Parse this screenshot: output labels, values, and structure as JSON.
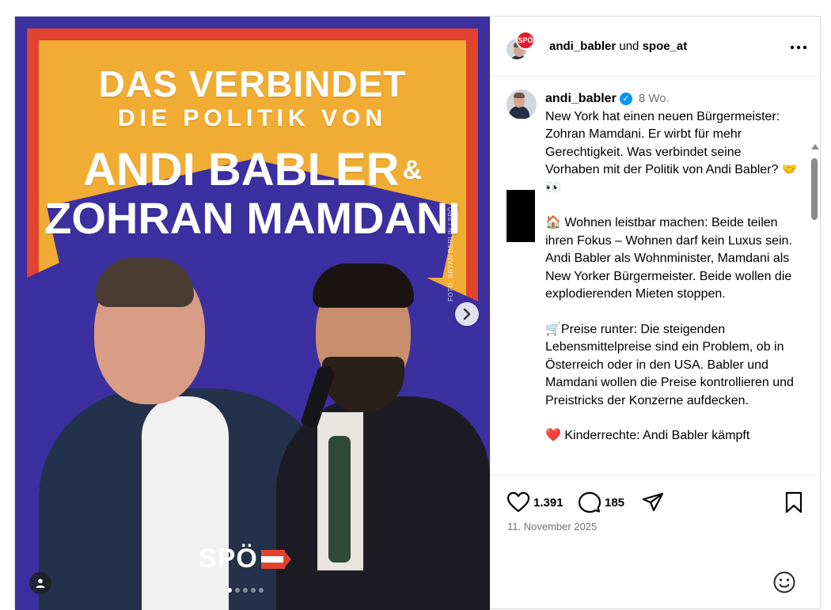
{
  "poster": {
    "headline_line1": "DAS VERBINDET",
    "headline_line2": "DIE POLITIK VON",
    "name_line1": "ANDI BABLER",
    "ampersand": "&",
    "name_line2": "ZOHRAN MAMDANI",
    "photo_credit": "FOTO: BRYAN BERLIN / SPÖ",
    "logo_text": "SPÖ",
    "carousel": {
      "total": 5,
      "active_index": 0
    }
  },
  "header": {
    "small_avatar_text": "SPÖ",
    "user1": "andi_babler",
    "joiner": " und ",
    "user2": "spoe_at",
    "more_icon": "more-horizontal-icon"
  },
  "caption": {
    "username": "andi_babler",
    "verified_icon": "verified-badge-icon",
    "time": "8 Wo.",
    "paragraphs": [
      "New York hat einen neuen Bürgermeister: Zohran Mamdani. Er wirbt für mehr Gerechtigkeit. Was verbindet seine Vorhaben mit der Politik von Andi Babler? 🤝👀",
      "🏠 Wohnen leistbar machen: Beide teilen ihren Fokus – Wohnen darf kein Luxus sein. Andi Babler als Wohnminister, Mamdani als New Yorker Bürgermeister. Beide wollen die explodierenden Mieten stoppen.",
      "🛒Preise runter: Die steigenden Lebensmittelpreise sind ein Problem, ob in Österreich oder in den USA. Babler und Mamdani wollen die Preise kontrollieren und Preistricks der Konzerne aufdecken.",
      "❤️ Kinderrechte: Andi Babler kämpft"
    ]
  },
  "actions": {
    "likes": "1.391",
    "comments": "185",
    "date": "11. November 2025"
  },
  "colors": {
    "poster_blue": "#3c2fa0",
    "poster_red": "#e0432e",
    "poster_yellow": "#f1ac33",
    "verified_blue": "#0095f6",
    "muted_text": "#737373"
  }
}
